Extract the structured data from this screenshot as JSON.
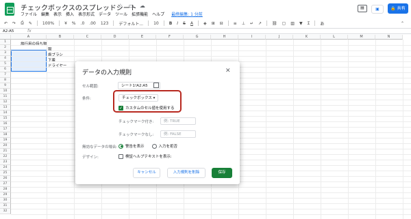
{
  "app": {
    "doc_title": "チェックボックスのスプレッドシート",
    "menu": [
      "ファイル",
      "編集",
      "表示",
      "挿入",
      "表示形式",
      "データ",
      "ツール",
      "拡張機能",
      "ヘルプ"
    ],
    "last_edit": "最終編集: 1 分前",
    "share_label": "共有"
  },
  "toolbar": {
    "zoom": "100%",
    "currency": "¥",
    "percent": "%",
    "decimal_dec": ".0",
    "decimal_inc": ".00",
    "number_format": "123",
    "font": "デフォルト...",
    "font_size": "10"
  },
  "formula_bar": {
    "name_box": "A2:A5",
    "fx": "fx"
  },
  "sheet": {
    "columns": [
      "A",
      "B",
      "C",
      "D",
      "E",
      "F",
      "G",
      "H",
      "I",
      "J",
      "K",
      "L",
      "M",
      "N"
    ],
    "rows": [
      "1",
      "2",
      "3",
      "4",
      "5",
      "6",
      "7",
      "8",
      "9",
      "10",
      "11",
      "12",
      "13",
      "14",
      "15",
      "16",
      "17",
      "18",
      "19",
      "20",
      "21",
      "22",
      "23",
      "24",
      "25",
      "26",
      "27",
      "28",
      "29",
      "30",
      "31",
      "32"
    ],
    "cells": {
      "A1": "旅行用の持ち物",
      "B2": "服",
      "B3": "歯ブラシ",
      "B4": "下着",
      "B5": "ドライヤー"
    }
  },
  "dialog": {
    "title": "データの入力規則",
    "range_label": "セル範囲:",
    "range_value": "シート1!A2:A5",
    "criteria_label": "条件:",
    "criteria_value": "チェックボックス",
    "custom_values_label": "カスタムのセル値を使用する",
    "custom_values_checked": true,
    "checked_label": "チェックマーク付き:",
    "checked_placeholder": "例: TRUE",
    "unchecked_label": "チェックマークなし:",
    "unchecked_placeholder": "例: FALSE",
    "invalid_label": "無効なデータの場合:",
    "invalid_options": [
      "警告を表示",
      "入力を拒否"
    ],
    "invalid_selected": "警告を表示",
    "design_label": "デザイン:",
    "help_text_label": "検証ヘルプテキストを表示:",
    "cancel_label": "キャンセル",
    "remove_label": "入力規則を削除",
    "save_label": "保存"
  }
}
